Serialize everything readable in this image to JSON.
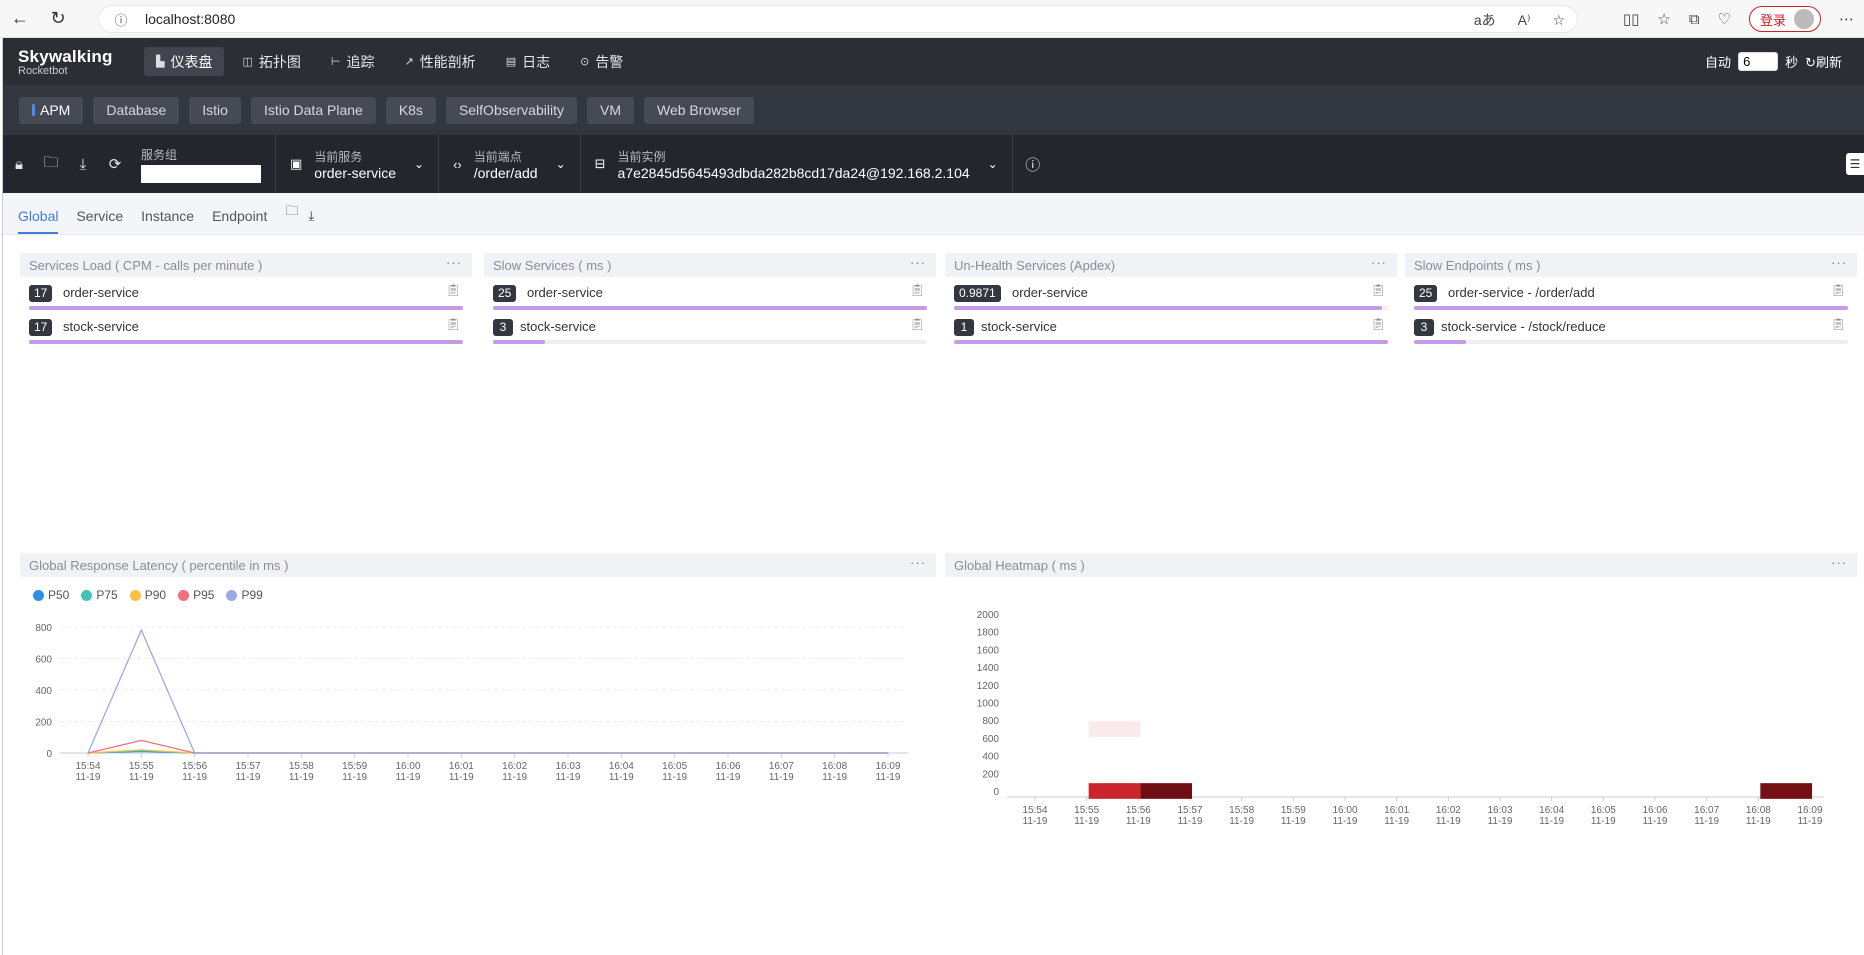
{
  "browser": {
    "url": "localhost:8080",
    "login_label": "登录"
  },
  "app": {
    "logo_title": "Skywalking",
    "logo_subtitle": "Rocketbot",
    "menu": [
      {
        "label": "仪表盘",
        "icon": "bar-chart-icon",
        "active": true
      },
      {
        "label": "拓扑图",
        "icon": "topology-icon",
        "active": false
      },
      {
        "label": "追踪",
        "icon": "trace-icon",
        "active": false
      },
      {
        "label": "性能剖析",
        "icon": "profile-icon",
        "active": false
      },
      {
        "label": "日志",
        "icon": "log-icon",
        "active": false
      },
      {
        "label": "告警",
        "icon": "alarm-icon",
        "active": false
      }
    ],
    "auto_label": "自动",
    "interval_value": "6",
    "seconds_label": "秒",
    "refresh_label": "刷新"
  },
  "dashboard_tabs": [
    "APM",
    "Database",
    "Istio",
    "Istio Data Plane",
    "K8s",
    "SelfObservability",
    "VM",
    "Web Browser"
  ],
  "selectors": {
    "group_label": "服务组",
    "group_value": "",
    "service_label": "当前服务",
    "service_value": "order-service",
    "endpoint_label": "当前端点",
    "endpoint_value": "/order/add",
    "instance_label": "当前实例",
    "instance_value": "a7e2845d5645493dbda282b8cd17da24@192.168.2.104"
  },
  "scope_tabs": [
    "Global",
    "Service",
    "Instance",
    "Endpoint"
  ],
  "panels": {
    "services_load": {
      "title": "Services Load ( CPM - calls per minute )",
      "rows": [
        {
          "value": "17",
          "name": "order-service",
          "fraction": 1.0
        },
        {
          "value": "17",
          "name": "stock-service",
          "fraction": 1.0
        }
      ]
    },
    "slow_services": {
      "title": "Slow Services ( ms )",
      "rows": [
        {
          "value": "25",
          "name": "order-service",
          "fraction": 1.0
        },
        {
          "value": "3",
          "name": "stock-service",
          "fraction": 0.12
        }
      ]
    },
    "unhealth_services": {
      "title": "Un-Health Services (Apdex)",
      "rows": [
        {
          "value": "0.9871",
          "name": "order-service",
          "fraction": 0.987
        },
        {
          "value": "1",
          "name": "stock-service",
          "fraction": 1.0
        }
      ]
    },
    "slow_endpoints": {
      "title": "Slow Endpoints ( ms )",
      "rows": [
        {
          "value": "25",
          "name": "order-service - /order/add",
          "fraction": 1.0
        },
        {
          "value": "3",
          "name": "stock-service - /stock/reduce",
          "fraction": 0.12
        }
      ]
    },
    "latency_title": "Global Response Latency ( percentile in ms )",
    "heatmap_title": "Global Heatmap ( ms )"
  },
  "chart_data": [
    {
      "type": "line",
      "x": [
        "15:54\n11-19",
        "15:55\n11-19",
        "15:56\n11-19",
        "15:57\n11-19",
        "15:58\n11-19",
        "15:59\n11-19",
        "16:00\n11-19",
        "16:01\n11-19",
        "16:02\n11-19",
        "16:03\n11-19",
        "16:04\n11-19",
        "16:05\n11-19",
        "16:06\n11-19",
        "16:07\n11-19",
        "16:08\n11-19",
        "16:09\n11-19"
      ],
      "series": [
        {
          "name": "P50",
          "color": "#2e8ee8",
          "values": [
            0,
            10,
            0,
            0,
            0,
            0,
            0,
            0,
            0,
            0,
            0,
            0,
            0,
            0,
            0,
            0
          ]
        },
        {
          "name": "P75",
          "color": "#42c3b6",
          "values": [
            0,
            15,
            0,
            0,
            0,
            0,
            0,
            0,
            0,
            0,
            0,
            0,
            0,
            0,
            0,
            0
          ]
        },
        {
          "name": "P90",
          "color": "#f7c245",
          "values": [
            0,
            20,
            0,
            0,
            0,
            0,
            0,
            0,
            0,
            0,
            0,
            0,
            0,
            0,
            0,
            0
          ]
        },
        {
          "name": "P95",
          "color": "#f36f7f",
          "values": [
            0,
            80,
            0,
            0,
            0,
            0,
            0,
            0,
            0,
            0,
            0,
            0,
            0,
            0,
            0,
            0
          ]
        },
        {
          "name": "P99",
          "color": "#9ea8e8",
          "values": [
            0,
            780,
            0,
            0,
            0,
            0,
            0,
            0,
            0,
            0,
            0,
            0,
            0,
            0,
            0,
            0
          ]
        }
      ],
      "ylim": [
        0,
        800
      ],
      "yticks": [
        0,
        200,
        400,
        600,
        800
      ],
      "grid": true,
      "legend": "top-left"
    },
    {
      "type": "heatmap",
      "x": [
        "15:54\n11-19",
        "15:55\n11-19",
        "15:56\n11-19",
        "15:57\n11-19",
        "15:58\n11-19",
        "15:59\n11-19",
        "16:00\n11-19",
        "16:01\n11-19",
        "16:02\n11-19",
        "16:03\n11-19",
        "16:04\n11-19",
        "16:05\n11-19",
        "16:06\n11-19",
        "16:07\n11-19",
        "16:08\n11-19",
        "16:09\n11-19"
      ],
      "yticks": [
        0,
        200,
        400,
        600,
        800,
        1000,
        1200,
        1400,
        1600,
        1800,
        2000
      ],
      "cells": [
        {
          "x": "15:55\n11-19",
          "y": 0,
          "color": "#c9252b"
        },
        {
          "x": "15:56\n11-19",
          "y": 0,
          "color": "#6e0e14"
        },
        {
          "x": "15:55\n11-19",
          "y": 700,
          "color": "#fbeaea"
        },
        {
          "x": "16:08\n11-19",
          "y": 0,
          "color": "#751016"
        }
      ]
    }
  ]
}
